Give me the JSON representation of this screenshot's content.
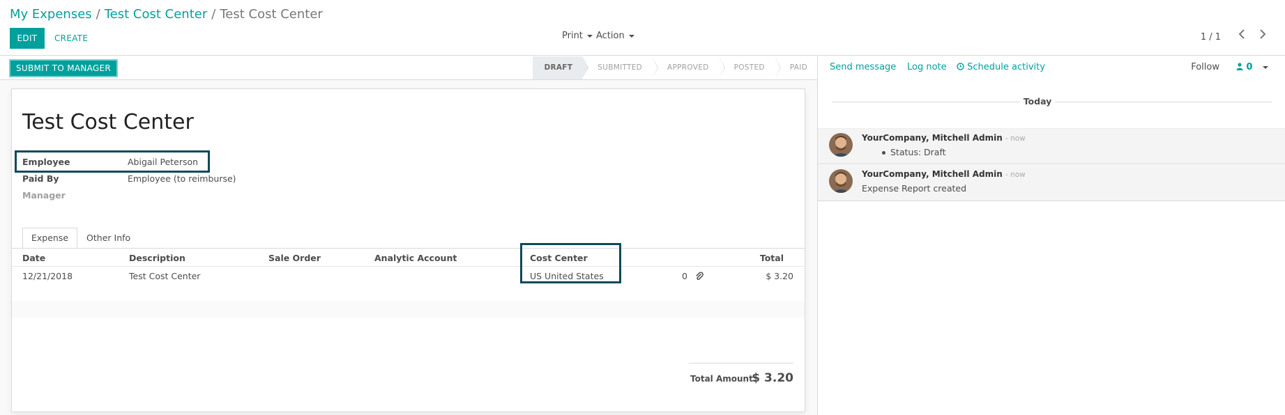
{
  "breadcrumb": {
    "items": [
      "My Expenses",
      "Test Cost Center"
    ],
    "separator": "/",
    "current": "Test Cost Center"
  },
  "buttons": {
    "edit": "EDIT",
    "create": "CREATE"
  },
  "menus": {
    "print": "Print",
    "action": "Action"
  },
  "pager": {
    "value": "1 / 1"
  },
  "statusbar": {
    "submit": "SUBMIT TO MANAGER",
    "stages": [
      "DRAFT",
      "SUBMITTED",
      "APPROVED",
      "POSTED",
      "PAID"
    ],
    "current": "DRAFT"
  },
  "form": {
    "title": "Test Cost Center",
    "employee_label": "Employee",
    "employee_value": "Abigail Peterson",
    "paid_by_label": "Paid By",
    "paid_by_value": "Employee (to reimburse)",
    "manager_label": "Manager"
  },
  "tabs": [
    "Expense",
    "Other Info"
  ],
  "table": {
    "headers": [
      "Date",
      "Description",
      "Sale Order",
      "Analytic Account",
      "Cost Center",
      "Total"
    ],
    "rows": [
      {
        "date": "12/21/2018",
        "description": "Test Cost Center",
        "sale_order": "",
        "analytic_account": "",
        "cost_center": "US United States",
        "attachments": "0",
        "total": "$ 3.20"
      }
    ]
  },
  "totals": {
    "label": "Total Amount:",
    "value": "$ 3.20"
  },
  "chatter": {
    "send_message": "Send message",
    "log_note": "Log note",
    "schedule_activity": "Schedule activity",
    "follow": "Follow",
    "followers_count": "0",
    "date_separator": "Today",
    "messages": [
      {
        "author": "YourCompany, Mitchell Admin",
        "time": "- now",
        "body": "Status: Draft"
      },
      {
        "author": "YourCompany, Mitchell Admin",
        "time": "- now",
        "body": "Expense Report created"
      }
    ]
  },
  "colors": {
    "primary": "#00a09d",
    "highlight_box": "#0d4a5a"
  },
  "icons": {
    "pager_prev": "chevron-left-icon",
    "pager_next": "chevron-right-icon",
    "attachment": "paperclip-icon",
    "schedule": "clock-icon",
    "followers": "user-icon"
  }
}
